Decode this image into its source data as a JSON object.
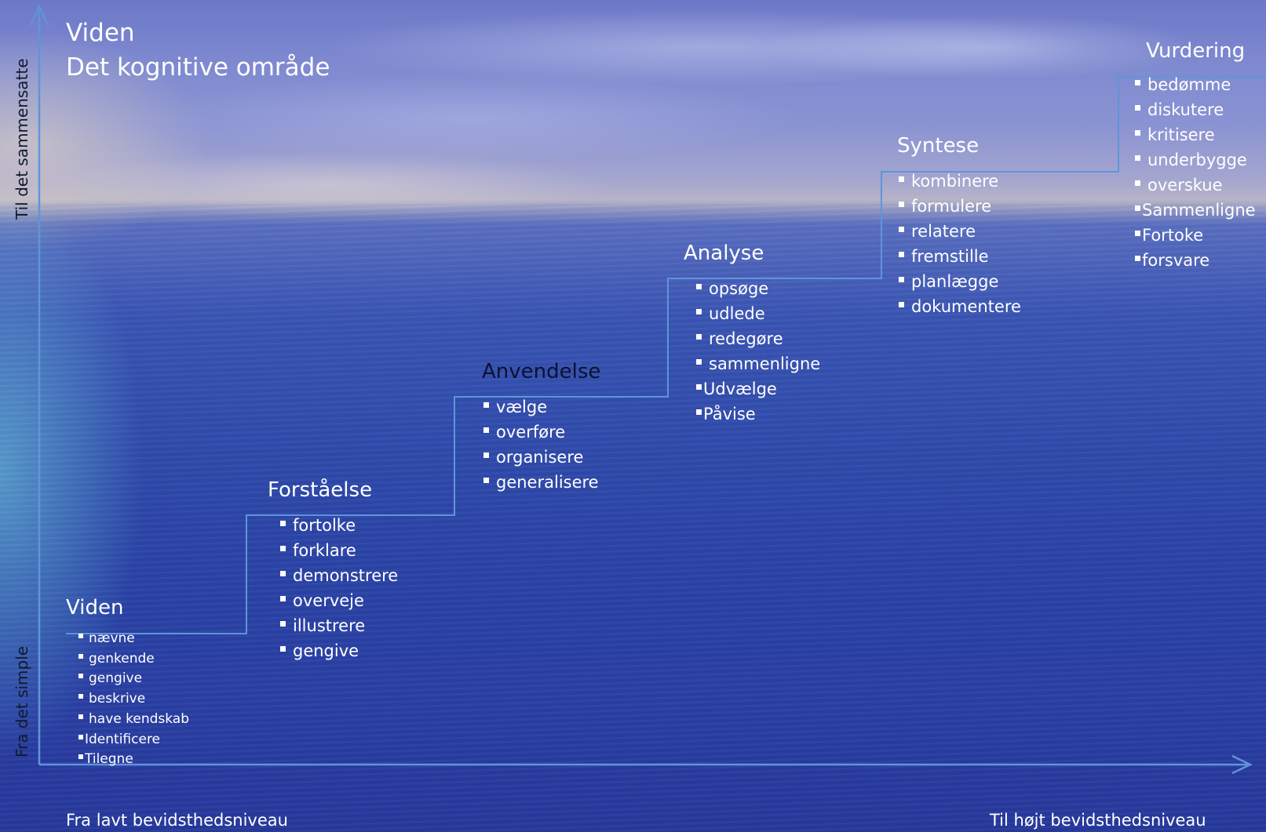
{
  "title": {
    "line1": "Viden",
    "line2": "Det kognitive område"
  },
  "axes": {
    "y_top_label": "Til det sammensatte",
    "y_bottom_label": "Fra det simple",
    "x_left_label": "Fra lavt bevidsthedsniveau",
    "x_right_label": "Til højt bevidsthedsniveau"
  },
  "levels": [
    {
      "title": "Viden",
      "items": [
        "nævne",
        "genkende",
        "gengive",
        "beskrive",
        "have kendskab",
        "Identificere",
        "Tilegne"
      ]
    },
    {
      "title": "Forståelse",
      "items": [
        "fortolke",
        "forklare",
        "demonstrere",
        "overveje",
        "illustrere",
        "gengive"
      ]
    },
    {
      "title": "Anvendelse",
      "items": [
        "vælge",
        "overføre",
        "organisere",
        "generalisere"
      ]
    },
    {
      "title": "Analyse",
      "items": [
        "opsøge",
        "udlede",
        "redegøre",
        "sammenligne",
        "Udvælge",
        "Påvise"
      ]
    },
    {
      "title": "Syntese",
      "items": [
        "kombinere",
        "formulere",
        "relatere",
        "fremstille",
        "planlægge",
        "dokumentere"
      ]
    },
    {
      "title": "Vurdering",
      "items": [
        "bedømme",
        "diskutere",
        "kritisere",
        "underbygge",
        "overskue",
        "Sammenligne",
        "Fortoke",
        "forsvare"
      ]
    }
  ],
  "colors": {
    "line": "#5f95d8",
    "text": "#ffffff",
    "dark_text": "#0b1230"
  }
}
